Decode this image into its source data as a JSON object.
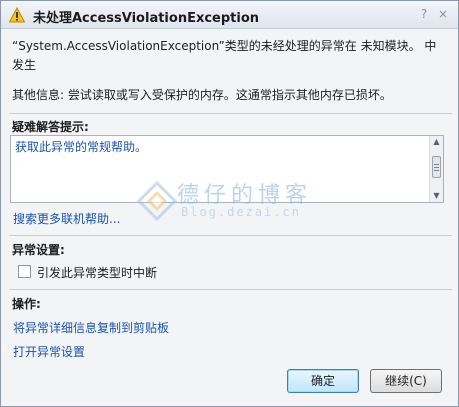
{
  "window": {
    "title": "未处理AccessViolationException",
    "help_glyph": "?",
    "close_glyph": "×"
  },
  "message": {
    "text": "“System.AccessViolationException”类型的未经处理的异常在 未知模块。 中发生",
    "extra_info": "其他信息: 尝试读取或写入受保护的内存。这通常指示其他内存已损坏。"
  },
  "troubleshooting": {
    "title": "疑难解答提示:",
    "tips": [
      "获取此异常的常规帮助。"
    ],
    "more_link": "搜索更多联机帮助..."
  },
  "exception_settings": {
    "title": "异常设置:",
    "checkbox_label": "引发此异常类型时中断",
    "checked": false
  },
  "actions": {
    "title": "操作:",
    "items": [
      "将异常详细信息复制到剪贴板",
      "打开异常设置"
    ]
  },
  "buttons": {
    "ok": "确定",
    "continue": "继续(C)"
  },
  "watermark": {
    "title": "德仔的博客",
    "subtitle": "Blog.dezai.cn"
  },
  "colors": {
    "link": "#1a53b0",
    "warning": "#f5c518",
    "background": "#f3f4f6"
  },
  "icons": {
    "title": "warning-icon",
    "help": "help-icon",
    "close": "close-icon"
  }
}
